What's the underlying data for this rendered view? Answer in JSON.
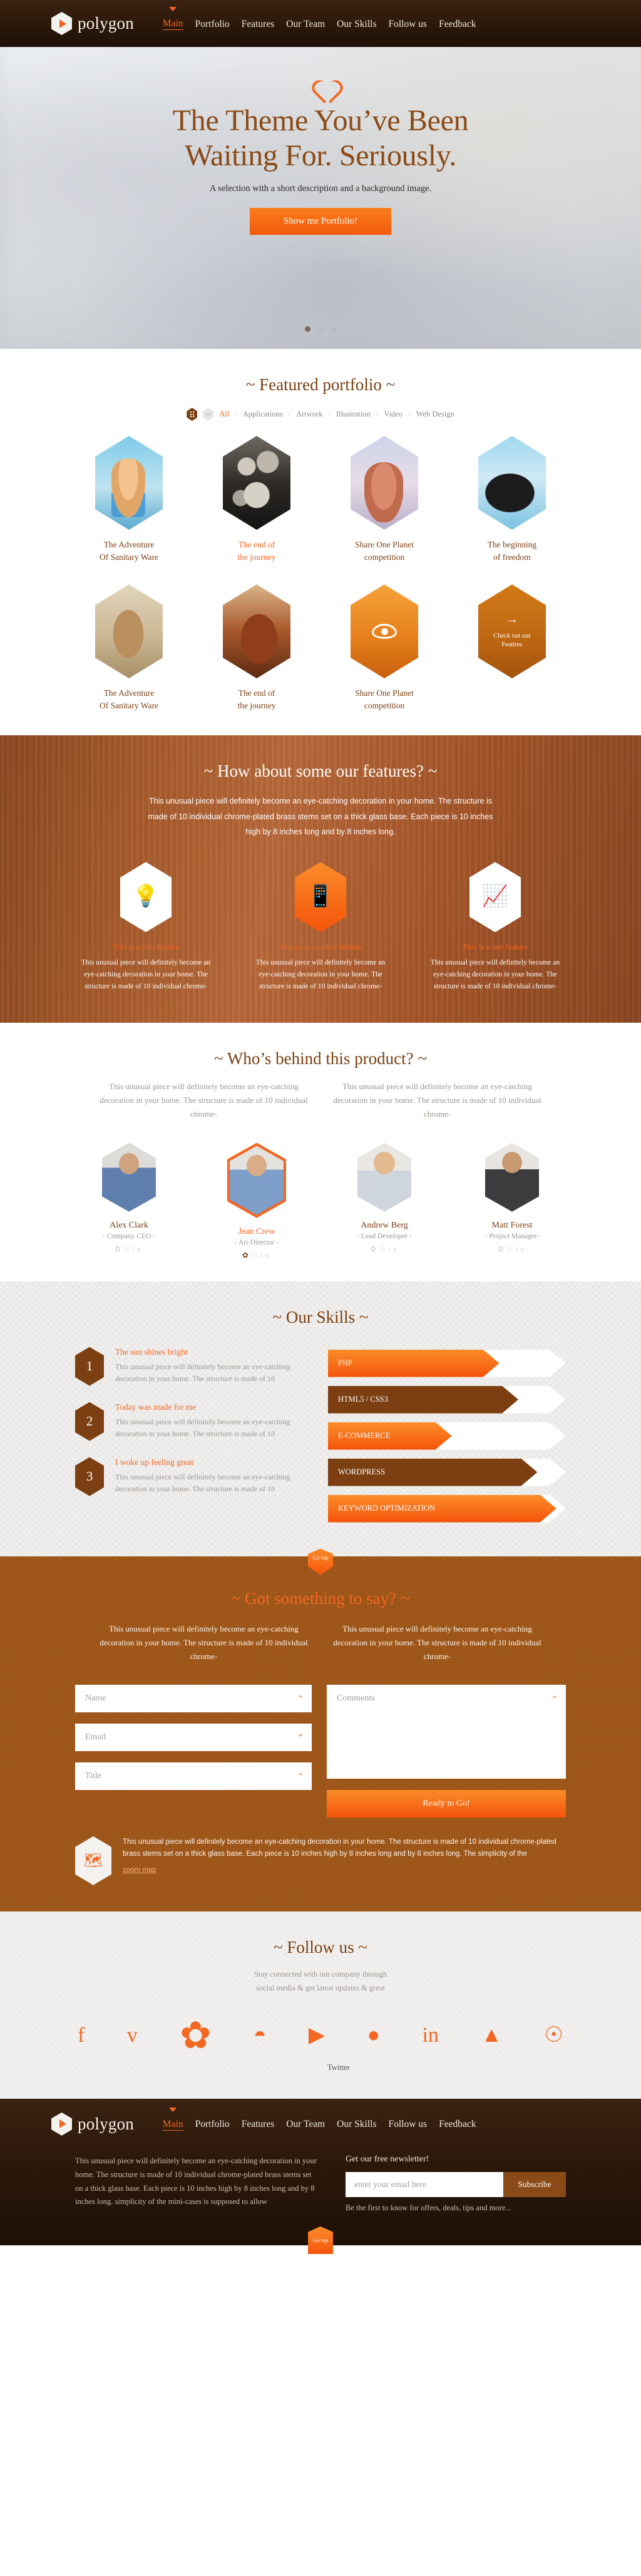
{
  "colors": {
    "accent": "#f26722",
    "brown": "#7b3f12",
    "dark": "#2a1708"
  },
  "header": {
    "logo_text": "polygon",
    "nav": [
      {
        "label": "Main",
        "active": true
      },
      {
        "label": "Portfolio",
        "active": false
      },
      {
        "label": "Features",
        "active": false
      },
      {
        "label": "Our Team",
        "active": false
      },
      {
        "label": "Our Skills",
        "active": false
      },
      {
        "label": "Follow us",
        "active": false
      },
      {
        "label": "Feedback",
        "active": false
      }
    ]
  },
  "hero": {
    "icon": "heart-icon",
    "title_line1": "The Theme You’ve Been",
    "title_line2": "Waiting For. Seriously.",
    "subtitle": "A selection with a short description and a background image.",
    "cta": "Show me Portfolio!",
    "slides": 3,
    "active_slide": 1
  },
  "portfolio": {
    "title": "~ Featured portfolio ~",
    "filters": [
      "All",
      "Applications",
      "Artwork",
      "Illustration",
      "Video",
      "Web Design"
    ],
    "active_filter": "All",
    "items": [
      {
        "caption_line1": "The Adventure",
        "caption_line2": "Of Sanitary Ware",
        "highlight": false
      },
      {
        "caption_line1": "The end of",
        "caption_line2": "the journey",
        "highlight": true
      },
      {
        "caption_line1": "Share One Planet",
        "caption_line2": "competition",
        "highlight": false
      },
      {
        "caption_line1": "The beginning",
        "caption_line2": "of freedom",
        "highlight": false
      },
      {
        "caption_line1": "The Adventure",
        "caption_line2": "Of Sanitary Ware",
        "highlight": false
      },
      {
        "caption_line1": "The end of",
        "caption_line2": "the journey",
        "highlight": false
      },
      {
        "caption_line1": "Share One Planet",
        "caption_line2": "competition",
        "highlight": false
      }
    ],
    "more_tile": {
      "line1": "Check out our",
      "line2": "Featires",
      "icon": "arrow-right-icon"
    }
  },
  "features": {
    "title": "~ How about some our features? ~",
    "intro": "This unusual piece will definitely become an eye-catching decoration in your home. The structure is made of 10 individual chrome-plated brass stems set on a thick glass base. Each piece is 10 inches high by 8 inches long and by 8 inches long.",
    "items": [
      {
        "icon": "lightbulb-icon",
        "title": "This is a first feature",
        "text": "This unusual piece will definitely become an eye-catching decoration in your home. The structure is made of 10 individual chrome-",
        "active": false
      },
      {
        "icon": "mobile-heart-icon",
        "title": "This is an another feature",
        "text": "This unusual piece will definitely become an eye-catching decoration in your home. The structure is made of 10 individual chrome-",
        "active": true
      },
      {
        "icon": "bar-chart-icon",
        "title": "This is a last feature",
        "text": "This unusual piece will definitely become an eye-catching decoration in your home. The structure is made of 10 individual chrome-",
        "active": false
      }
    ]
  },
  "team": {
    "title": "~ Who’s behind this product? ~",
    "intro_left": "This unusual piece will definitely become an eye-catching decoration in your home. The structure is made of 10 individual chrome-",
    "intro_right": "This unusual piece will definitely become an eye-catching decoration in your home. The structure is made of 10 individual chrome-",
    "members": [
      {
        "name": "Alex Clark",
        "role": "- Company CEO -",
        "selected": false
      },
      {
        "name": "Jean Crew",
        "role": "- Art-Director -",
        "selected": true
      },
      {
        "name": "Andrew Berg",
        "role": "- Lead Developer -",
        "selected": false
      },
      {
        "name": "Matt Forest",
        "role": "- Project Manager-",
        "selected": false
      }
    ],
    "social_icons": [
      "twitter-icon",
      "pinterest-icon",
      "linkedin-icon"
    ]
  },
  "skills": {
    "title": "~ Our Skills ~",
    "steps": [
      {
        "num": "1",
        "title": "The sun shines bright",
        "text": "This unusual piece will definitely become an eye-catching decoration in your home. The structure is made of 10"
      },
      {
        "num": "2",
        "title": "Today was made for me",
        "text": "This unusual piece will definitely become an eye-catching decoration in your home. The structure is made of 10"
      },
      {
        "num": "3",
        "title": "I woke up feeling great",
        "text": "This unusual piece will definitely become an eye-catching decoration in your home. The structure is made of 10"
      }
    ],
    "bars": [
      {
        "label": "PHP",
        "percent": 72,
        "style": "orange"
      },
      {
        "label": "HTML5 / CSS3",
        "percent": 80,
        "style": "brown"
      },
      {
        "label": "E-COMMERCE",
        "percent": 52,
        "style": "orange"
      },
      {
        "label": "WORDPRESS",
        "percent": 88,
        "style": "brown"
      },
      {
        "label": "KEYWORD OPTIMIZATION",
        "percent": 96,
        "style": "orange"
      }
    ]
  },
  "contact": {
    "go_top": "Go top",
    "title": "~ Got something to say? ~",
    "intro_left": "This unusual piece will definitely become an eye-catching decoration in your home. The structure is made of 10 individual chrome-",
    "intro_right": "This unusual piece will definitely become an eye-catching decoration in your home. The structure is made of 10 individual chrome-",
    "fields": {
      "name_placeholder": "Name",
      "email_placeholder": "Email",
      "title_placeholder": "Title",
      "comments_placeholder": "Comments",
      "required_mark": "*"
    },
    "submit": "Ready to Go!",
    "map_icon": "map-icon",
    "map_text": "This unusual piece will definitely become an eye-catching decoration in your home. The structure is made of 10 individual chrome-plated brass stems set on a thick glass base. Each piece is 10 inches high by 8 inches long and by 8 inches long. The simplicity of the",
    "map_link": "zoom map"
  },
  "follow": {
    "title": "~ Follow us ~",
    "subtitle_line1": "Stay connected with our company through",
    "subtitle_line2": "social media & get latest updates & great",
    "icons": [
      "facebook-icon",
      "vimeo-icon",
      "twitter-icon",
      "rss-icon",
      "youtube-icon",
      "dribbble-icon",
      "linkedin-icon",
      "forrst-icon",
      "pinterest-icon"
    ],
    "active_label": "Twitter"
  },
  "footer": {
    "logo_text": "polygon",
    "nav": [
      {
        "label": "Main",
        "active": true
      },
      {
        "label": "Portfolio",
        "active": false
      },
      {
        "label": "Features",
        "active": false
      },
      {
        "label": "Our Team",
        "active": false
      },
      {
        "label": "Our Skills",
        "active": false
      },
      {
        "label": "Follow us",
        "active": false
      },
      {
        "label": "Feedback",
        "active": false
      }
    ],
    "about": "This unusual piece will definitely become an eye-catching decoration in your home. The structure is made of 10 individual chrome-plated brass stems set on a thick glass base. Each piece is 10 inches high by 8 inches long and by 8 inches long. simplicity of the mini-cases is supposed to allow",
    "newsletter_title": "Get our free newsletter!",
    "newsletter_placeholder": "enter your email here",
    "subscribe": "Subscribe",
    "newsletter_note": "Be the first to know for offers, deals, tips and more...",
    "go_top": "Go top"
  }
}
